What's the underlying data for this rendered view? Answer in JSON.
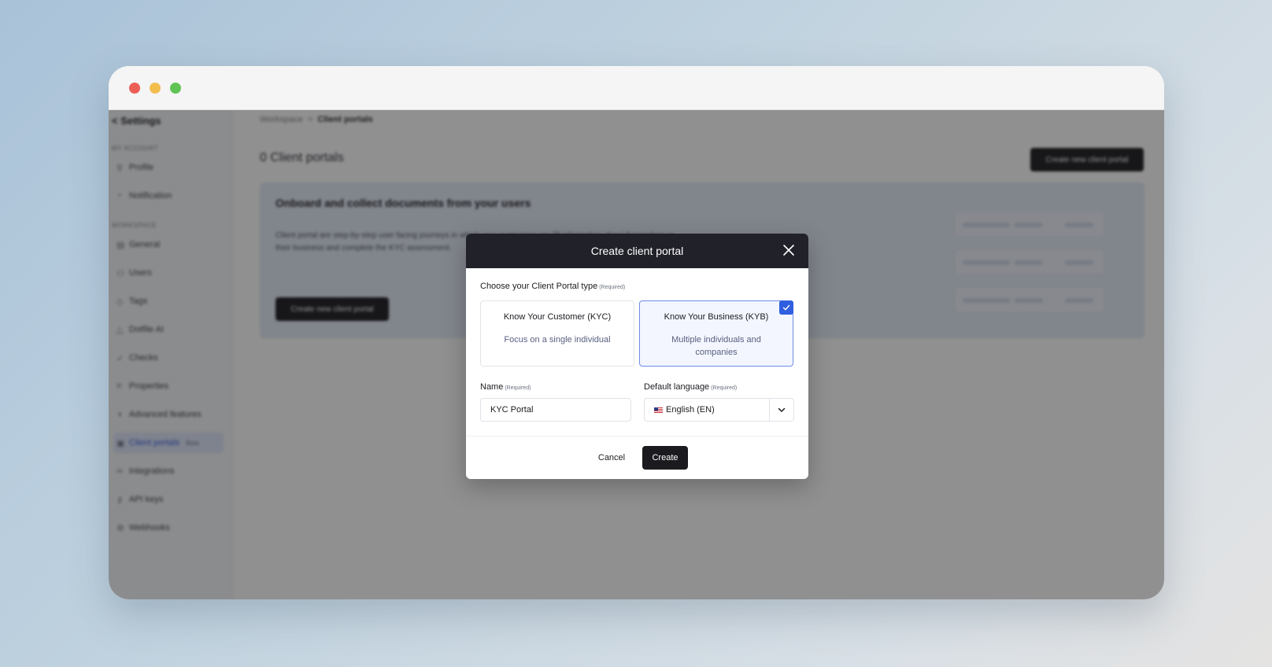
{
  "background_app": {
    "sidebar": {
      "back_label": "< Settings",
      "section_account": "MY ACCOUNT",
      "section_workspace": "WORKSPACE",
      "account_items": [
        {
          "label": "Profile",
          "icon": "person-icon"
        },
        {
          "label": "Notification",
          "icon": "bell-icon"
        }
      ],
      "workspace_items": [
        {
          "label": "General",
          "icon": "building-icon"
        },
        {
          "label": "Users",
          "icon": "users-icon"
        },
        {
          "label": "Tags",
          "icon": "tag-icon"
        },
        {
          "label": "Dotfile AI",
          "icon": "lock-icon"
        },
        {
          "label": "Checks",
          "icon": "check-icon"
        },
        {
          "label": "Properties",
          "icon": "list-icon"
        },
        {
          "label": "Advanced features",
          "icon": "toggle-icon"
        },
        {
          "label": "Client portals",
          "icon": "portal-icon",
          "badge": "Beta",
          "active": true
        },
        {
          "label": "Integrations",
          "icon": "link-icon"
        },
        {
          "label": "API keys",
          "icon": "key-icon"
        },
        {
          "label": "Webhooks",
          "icon": "webhook-icon"
        }
      ]
    },
    "breadcrumb": {
      "root": "Workspace",
      "separator": ">",
      "current": "Client portals"
    },
    "page_title": "0 Client portals",
    "create_button": "Create new client portal",
    "banner": {
      "title": "Onboard and collect documents from your users",
      "text": "Client portal are step-by-step user facing journeys in which your customers can fill information about themselves or their business and complete the KYC assessment.",
      "button": "Create new client portal"
    }
  },
  "modal": {
    "title": "Create client portal",
    "type_label": "Choose your Client Portal type",
    "required_tag": "(Required)",
    "options": [
      {
        "title": "Know Your Customer (KYC)",
        "description": "Focus on a single individual",
        "selected": false
      },
      {
        "title": "Know Your Business (KYB)",
        "description": "Multiple individuals and companies",
        "selected": true
      }
    ],
    "name_label": "Name",
    "name_value": "KYC Portal",
    "language_label": "Default language",
    "language_value": "English (EN)",
    "cancel_label": "Cancel",
    "create_label": "Create"
  },
  "colors": {
    "accent": "#2f5fe0",
    "modal_header": "#21212a",
    "primary_button": "#1b1b1f",
    "selected_bg": "#f3f6fe"
  }
}
